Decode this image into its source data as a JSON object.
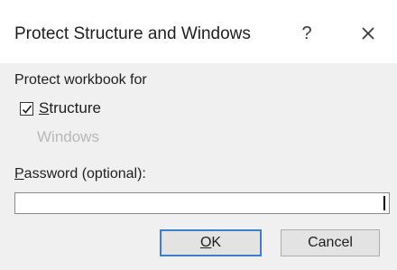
{
  "dialog": {
    "title": "Protect Structure and Windows",
    "help_label": "?",
    "close_icon": "close-icon"
  },
  "protect": {
    "section_label": "Protect workbook for",
    "structure": {
      "label_first": "S",
      "label_rest": "tructure",
      "checked": true,
      "enabled": true
    },
    "windows": {
      "label": "Windows",
      "checked": false,
      "enabled": false
    }
  },
  "password": {
    "label_first": "P",
    "label_rest": "assword (optional):",
    "value": ""
  },
  "buttons": {
    "ok_label_first": "O",
    "ok_label_rest": "K",
    "cancel_label": "Cancel"
  },
  "colors": {
    "ok_focus_border": "#3c7fd0",
    "client_background": "#f0f0f0"
  }
}
